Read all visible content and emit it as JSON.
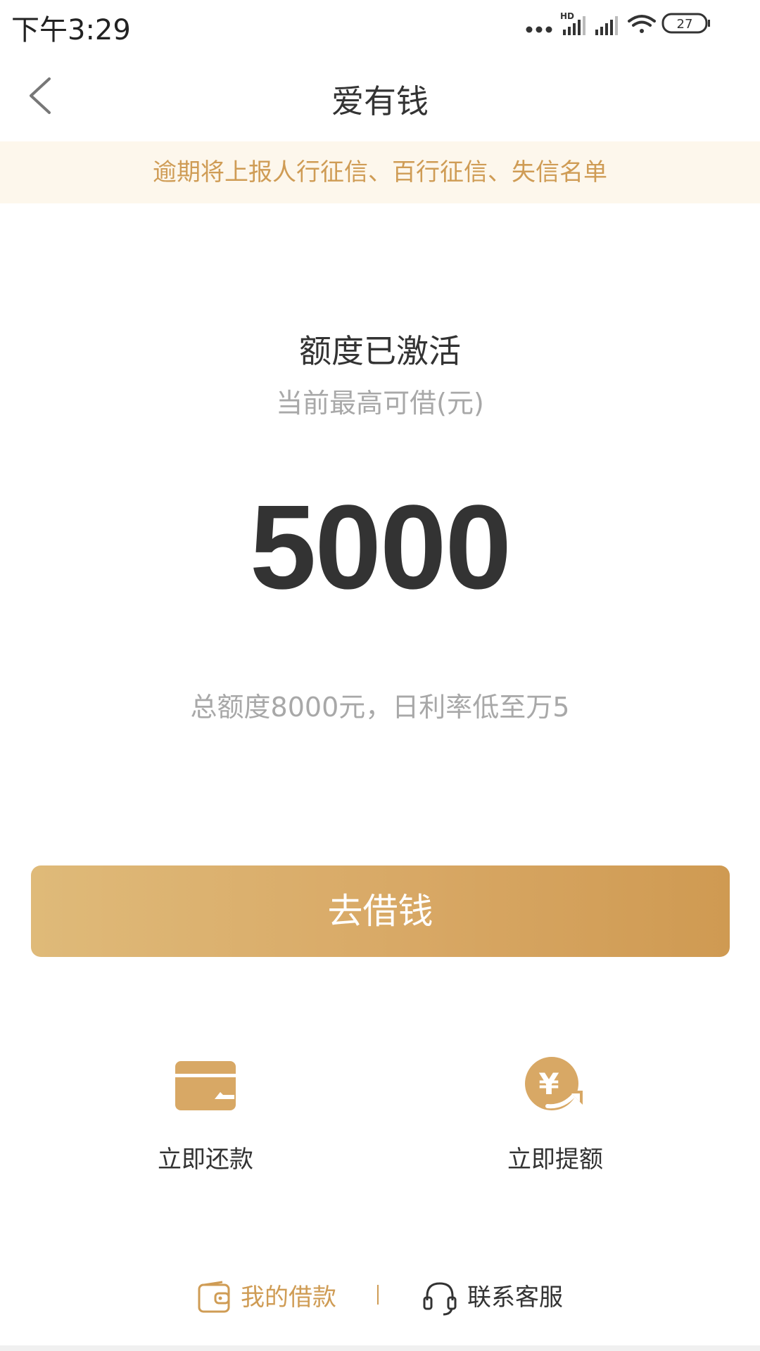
{
  "status_bar": {
    "time": "下午3:29",
    "network_label": "HD",
    "battery": "27"
  },
  "nav": {
    "title": "爱有钱"
  },
  "notice": {
    "text": "逾期将上报人行征信、百行征信、失信名单"
  },
  "credit": {
    "status": "额度已激活",
    "subtitle": "当前最高可借(元)",
    "amount": "5000",
    "description": "总额度8000元，日利率低至万5"
  },
  "primary_button": {
    "label": "去借钱"
  },
  "actions": [
    {
      "label": "立即还款",
      "icon": "card-icon"
    },
    {
      "label": "立即提额",
      "icon": "yuan-up-icon"
    }
  ],
  "footer": {
    "my_loans": "我的借款",
    "contact": "联系客服"
  },
  "colors": {
    "accent": "#cf9c55",
    "notice_bg": "#fdf7ec",
    "button_start": "#dfba79",
    "button_end": "#cf9a52"
  }
}
